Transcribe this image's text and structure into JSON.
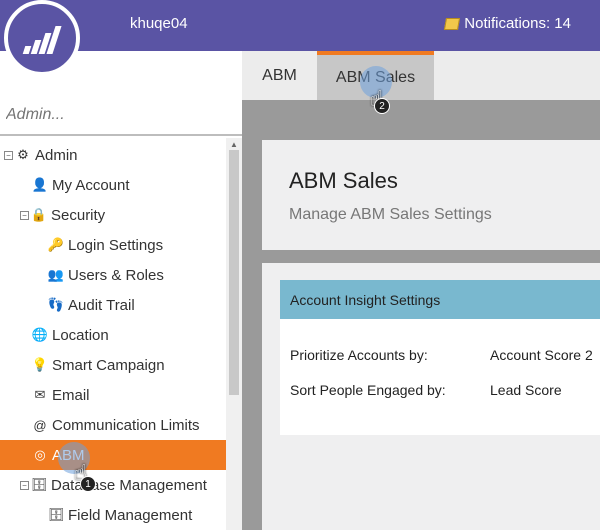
{
  "topbar": {
    "username": "khuqe04",
    "notifications": "Notifications: 14"
  },
  "tabs": [
    {
      "label": "ABM"
    },
    {
      "label": "ABM Sales"
    }
  ],
  "search": {
    "placeholder": "Admin..."
  },
  "tree": {
    "admin": "Admin",
    "my_account": "My Account",
    "security": "Security",
    "login_settings": "Login Settings",
    "users_roles": "Users & Roles",
    "audit_trail": "Audit Trail",
    "location": "Location",
    "smart_campaign": "Smart Campaign",
    "email": "Email",
    "communication_limits": "Communication Limits",
    "abm": "ABM",
    "database_management": "Database Management",
    "field_management": "Field Management"
  },
  "header": {
    "title": "ABM Sales",
    "subtitle": "Manage ABM Sales Settings"
  },
  "insight": {
    "title": "Account Insight Settings",
    "prioritize_label": "Prioritize Accounts by:",
    "prioritize_value": "Account Score 2",
    "sort_label": "Sort People Engaged by:",
    "sort_value": "Lead Score"
  },
  "callouts": {
    "step1": "1",
    "step2": "2"
  },
  "colors": {
    "brand": "#5a54a4",
    "accent": "#f07a21",
    "insight_bar": "#79b8cf"
  }
}
